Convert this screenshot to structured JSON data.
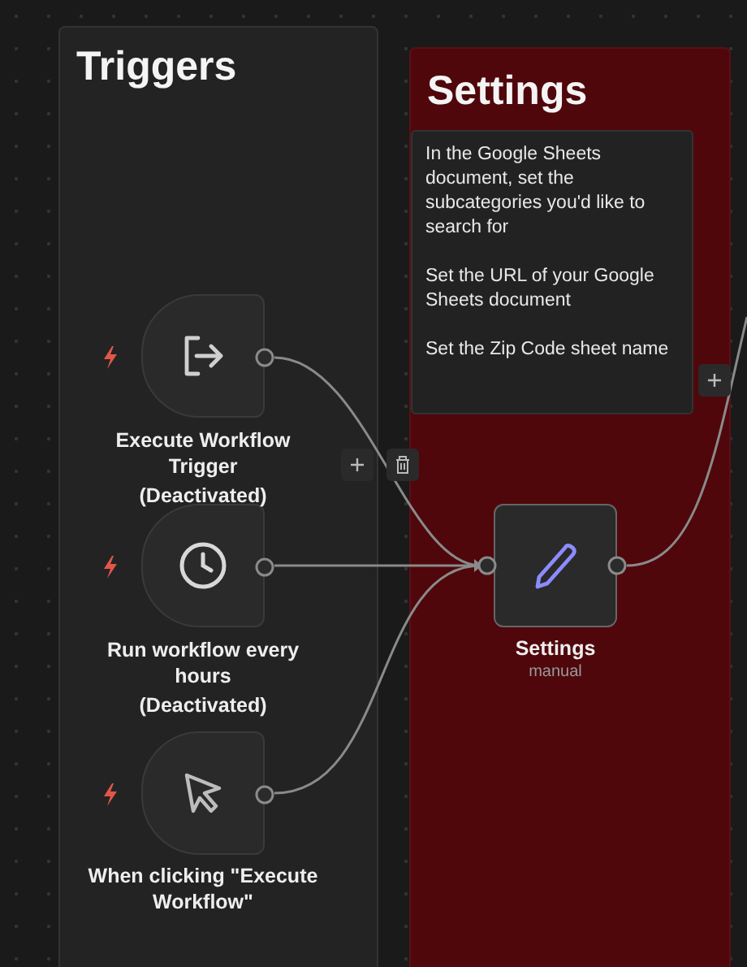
{
  "groups": [
    {
      "title": "Triggers",
      "kind": "plain"
    },
    {
      "title": "Settings",
      "kind": "red",
      "note": [
        "In the Google Sheets document, set the subcategories you'd like to search for",
        "Set the URL of your Google Sheets document",
        "Set the Zip Code sheet name"
      ]
    }
  ],
  "triggers": [
    {
      "kind": "exit",
      "name": "Execute Workflow Trigger",
      "status": "(Deactivated)"
    },
    {
      "kind": "clock",
      "name": "Run workflow every hours",
      "status": "(Deactivated)"
    },
    {
      "kind": "cursor",
      "name": "When clicking \"Execute Workflow\""
    }
  ],
  "settings_node": {
    "name": "Settings",
    "subtitle": "manual"
  }
}
